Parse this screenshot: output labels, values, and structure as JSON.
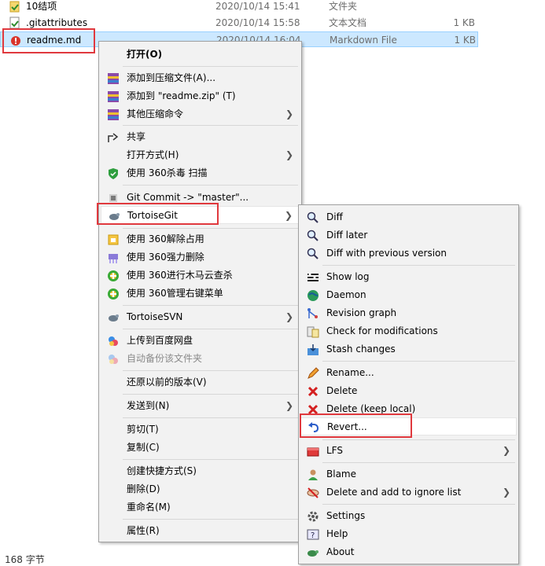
{
  "files": [
    {
      "name": "10结项",
      "date": "2020/10/14 15:41",
      "type": "文件夹",
      "size": "",
      "icon": "folder-icon"
    },
    {
      "name": ".gitattributes",
      "date": "2020/10/14 15:58",
      "type": "文本文档",
      "size": "1 KB",
      "icon": "text-file-icon"
    },
    {
      "name": "readme.md",
      "date": "2020/10/14 16:04",
      "type": "Markdown File",
      "size": "1 KB",
      "icon": "markdown-file-icon"
    }
  ],
  "main_menu": {
    "open": "打开(O)",
    "add_archive": "添加到压缩文件(A)...",
    "add_zip": "添加到 \"readme.zip\" (T)",
    "other_compress": "其他压缩命令",
    "share": "共享",
    "open_with": "打开方式(H)",
    "scan_360": "使用 360杀毒 扫描",
    "git_commit": "Git Commit -> \"master\"...",
    "tortoisegit": "TortoiseGit",
    "unlock_360": "使用 360解除占用",
    "force_delete_360": "使用 360强力删除",
    "trojan_scan_360": "使用 360进行木马云查杀",
    "manage_menu_360": "使用 360管理右键菜单",
    "tortoisesvn": "TortoiseSVN",
    "upload_baidu": "上传到百度网盘",
    "auto_backup": "自动备份该文件夹",
    "restore_prev": "还原以前的版本(V)",
    "send_to": "发送到(N)",
    "cut": "剪切(T)",
    "copy": "复制(C)",
    "create_shortcut": "创建快捷方式(S)",
    "delete": "删除(D)",
    "rename": "重命名(M)",
    "properties": "属性(R)"
  },
  "git_menu": {
    "diff": "Diff",
    "diff_later": "Diff later",
    "diff_prev": "Diff with previous version",
    "show_log": "Show log",
    "daemon": "Daemon",
    "revision_graph": "Revision graph",
    "check_mods": "Check for modifications",
    "stash": "Stash changes",
    "rename": "Rename...",
    "delete": "Delete",
    "delete_keep": "Delete (keep local)",
    "revert": "Revert...",
    "lfs": "LFS",
    "blame": "Blame",
    "delete_ignore": "Delete and add to ignore list",
    "settings": "Settings",
    "help": "Help",
    "about": "About"
  },
  "status_bar": {
    "size_text": "168 字节"
  },
  "colors": {
    "highlight": "#e0393e",
    "selection": "#cce8ff",
    "menu_bg": "#f2f2f2"
  }
}
